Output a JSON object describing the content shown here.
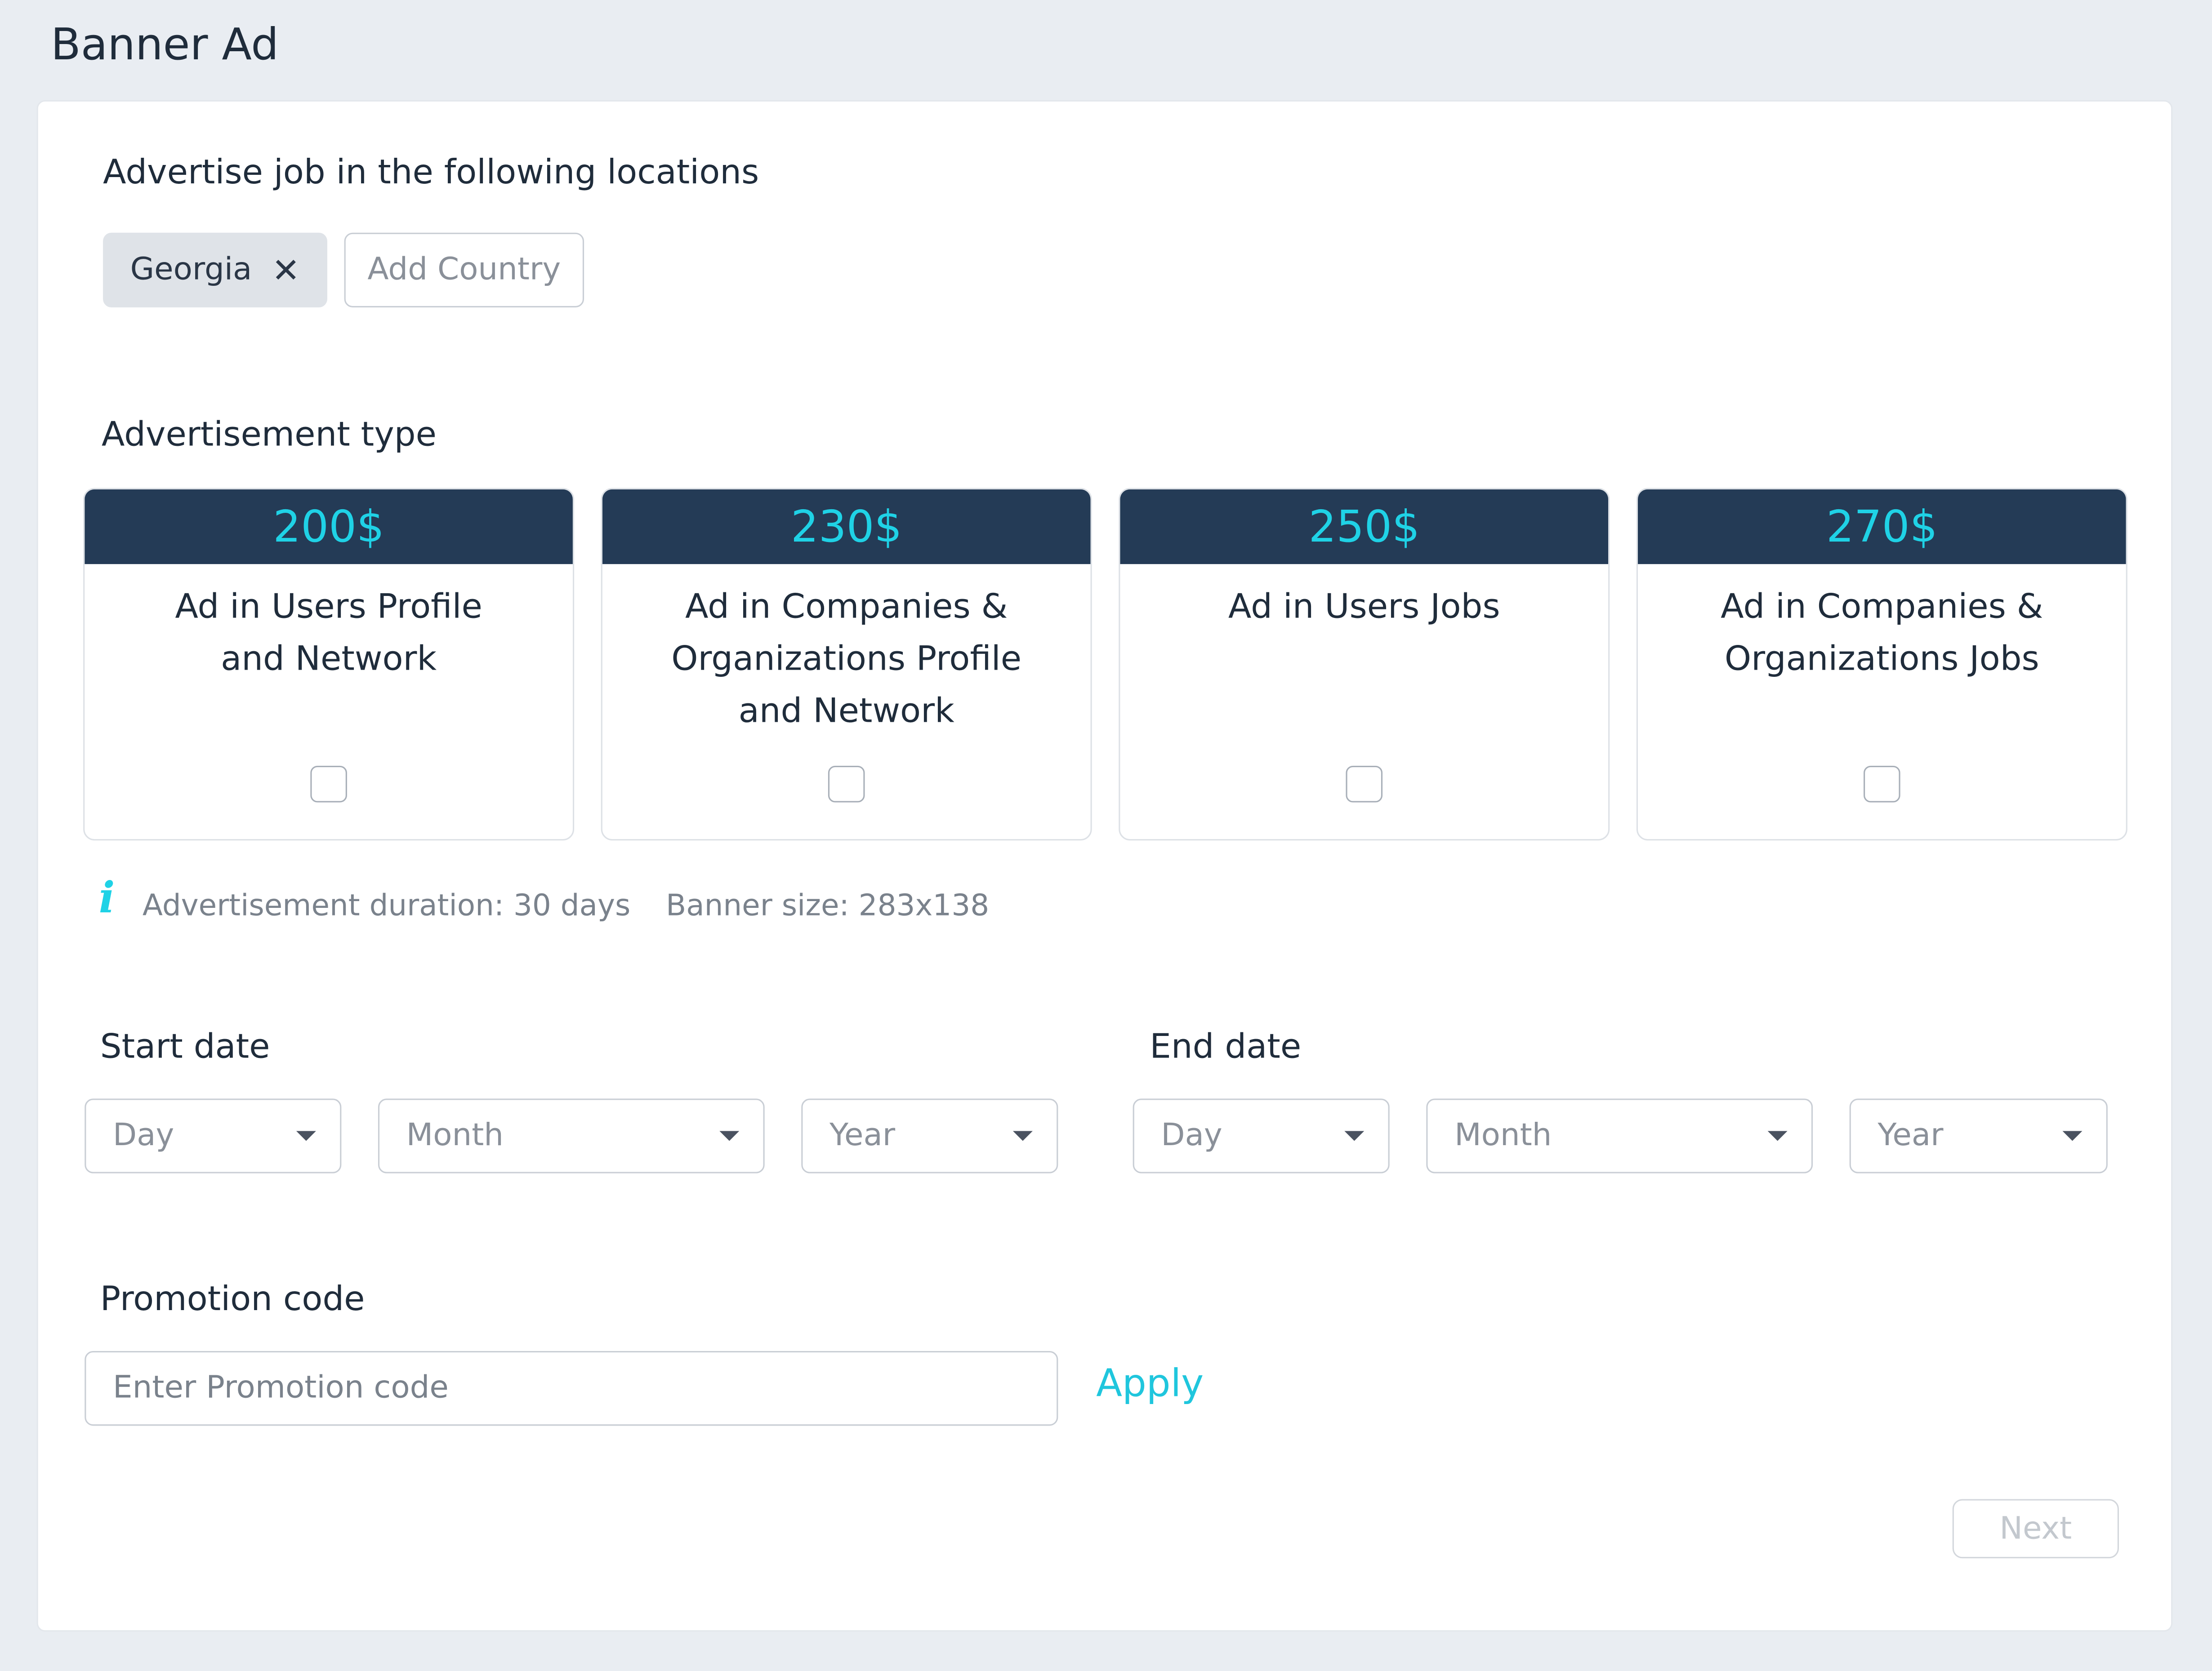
{
  "page_title": "Banner Ad",
  "locations": {
    "label": "Advertise job in the following locations",
    "selected": [
      {
        "name": "Georgia",
        "remove_icon": "close-icon"
      }
    ],
    "add_placeholder": "Add Country"
  },
  "ad_type": {
    "label": "Advertisement type",
    "options": [
      {
        "price": "200$",
        "title": "Ad in Users Profile\nand Network",
        "checked": false
      },
      {
        "price": "230$",
        "title": "Ad in Companies &\nOrganizations Profile\nand Network",
        "checked": false
      },
      {
        "price": "250$",
        "title": "Ad in Users Jobs",
        "checked": false
      },
      {
        "price": "270$",
        "title": "Ad in Companies &\nOrganizations Jobs",
        "checked": false
      }
    ]
  },
  "info": {
    "icon": "info-icon",
    "duration": "Advertisement duration: 30 days",
    "banner_size": "Banner size: 283x138"
  },
  "start_date": {
    "label": "Start date",
    "day": "Day",
    "month": "Month",
    "year": "Year"
  },
  "end_date": {
    "label": "End date",
    "day": "Day",
    "month": "Month",
    "year": "Year"
  },
  "promotion": {
    "label": "Promotion code",
    "placeholder": "Enter Promotion code",
    "apply_label": "Apply"
  },
  "next_label": "Next",
  "colors": {
    "accent": "#1fd2e6",
    "header_bg": "#243b56",
    "page_bg": "#e9edf2"
  }
}
